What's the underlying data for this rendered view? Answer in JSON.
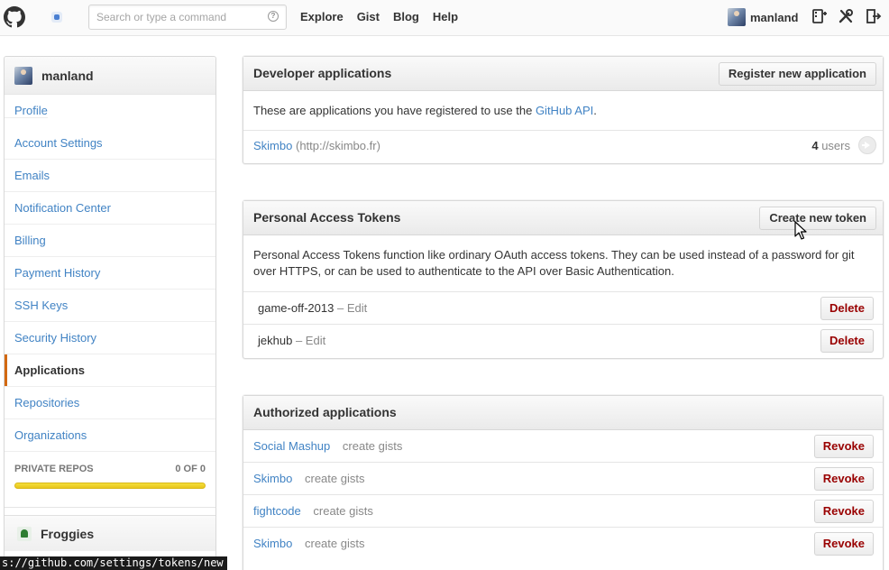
{
  "header": {
    "search_placeholder": "Search or type a command",
    "nav": [
      "Explore",
      "Gist",
      "Blog",
      "Help"
    ],
    "username": "manland",
    "icons": [
      "github-logo-icon",
      "notifications-icon",
      "help-icon",
      "new-repo-icon",
      "settings-tools-icon",
      "sign-out-icon"
    ]
  },
  "sidebar": {
    "username": "manland",
    "items": [
      {
        "label": "Profile"
      },
      {
        "label": "Account Settings"
      },
      {
        "label": "Emails"
      },
      {
        "label": "Notification Center"
      },
      {
        "label": "Billing"
      },
      {
        "label": "Payment History"
      },
      {
        "label": "SSH Keys"
      },
      {
        "label": "Security History"
      },
      {
        "label": "Applications",
        "selected": true
      },
      {
        "label": "Repositories"
      },
      {
        "label": "Organizations"
      }
    ],
    "private_repos_label": "PRIVATE REPOS",
    "private_repos_count": "0 OF 0",
    "private_repos_usage": 0,
    "org_name": "Froggies"
  },
  "developer_apps": {
    "title": "Developer applications",
    "register_button": "Register new application",
    "intro_prefix": "These are applications you have registered to use the",
    "intro_link": "GitHub API",
    "intro_suffix": ".",
    "apps": [
      {
        "name": "Skimbo",
        "url": "(http://skimbo.fr)",
        "users_count": "4",
        "users_label": "users"
      }
    ]
  },
  "tokens": {
    "title": "Personal Access Tokens",
    "create_button": "Create new token",
    "description": "Personal Access Tokens function like ordinary OAuth access tokens. They can be used instead of a password for git over HTTPS, or can be used to authenticate to the API over Basic Authentication.",
    "items": [
      {
        "name": "game-off-2013",
        "sep": "–",
        "edit_label": "Edit",
        "delete_label": "Delete"
      },
      {
        "name": "jekhub",
        "sep": "–",
        "edit_label": "Edit",
        "delete_label": "Delete"
      }
    ]
  },
  "authorized_apps": {
    "title": "Authorized applications",
    "items": [
      {
        "name": "Social Mashup",
        "scope": "create gists",
        "revoke_label": "Revoke"
      },
      {
        "name": "Skimbo",
        "scope": "create gists",
        "revoke_label": "Revoke"
      },
      {
        "name": "fightcode",
        "scope": "create gists",
        "revoke_label": "Revoke"
      },
      {
        "name": "Skimbo",
        "scope": "create gists",
        "revoke_label": "Revoke"
      }
    ]
  },
  "status_bar": {
    "url": "s://github.com/settings/tokens/new"
  }
}
